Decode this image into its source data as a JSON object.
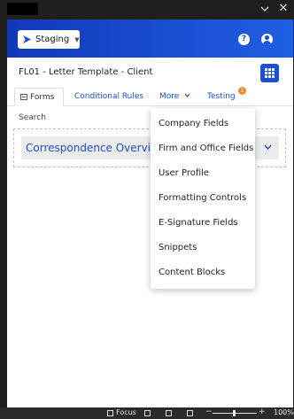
{
  "window": {
    "chevron_icon": "chevron-down-icon",
    "close_symbol": "✕"
  },
  "header": {
    "env_label": "Staging",
    "help_symbol": "?",
    "colors": {
      "header_start": "#1238b8",
      "header_end": "#1f5fe3",
      "accent": "#1f4fd0"
    }
  },
  "document": {
    "title": "FL01 - Letter Template - Client"
  },
  "tabs": {
    "forms": "Forms",
    "conditional_rules": "Conditional Rules",
    "more": "More",
    "testing": "Testing",
    "testing_badge": "1"
  },
  "search": {
    "label": "Search"
  },
  "section": {
    "title": "Correspondence Overview"
  },
  "more_menu": {
    "items": [
      "Company Fields",
      "Firm and Office Fields",
      "User Profile",
      "Formatting Controls",
      "E-Signature Fields",
      "Snippets",
      "Content Blocks"
    ]
  },
  "statusbar": {
    "focus_label": "Focus",
    "zoom": "100%"
  }
}
